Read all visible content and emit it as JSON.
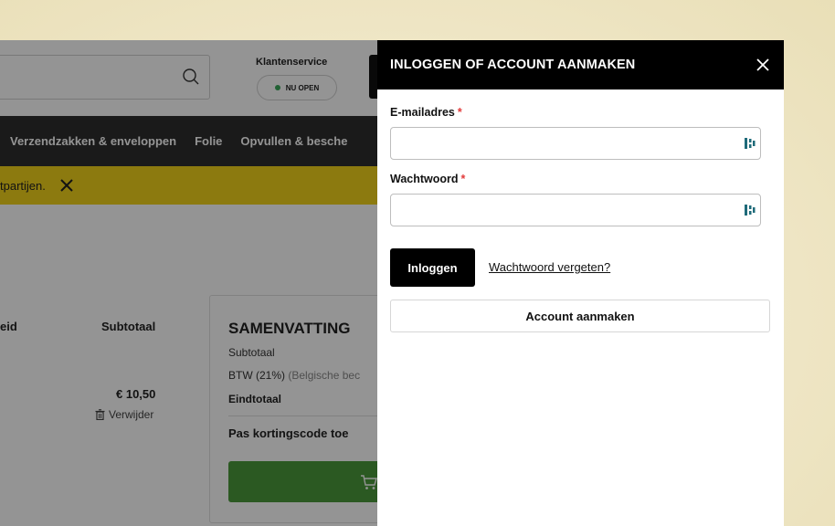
{
  "header": {
    "customer_service_label": "Klantenservice",
    "open_status": "NU OPEN"
  },
  "nav": {
    "items": [
      {
        "label": "Verzendzakken & enveloppen"
      },
      {
        "label": "Folie"
      },
      {
        "label": "Opvullen & besche"
      }
    ]
  },
  "notice": {
    "text": "tpartijen."
  },
  "cart": {
    "col_quantity": "eid",
    "col_subtotal": "Subtotaal",
    "item_price": "€ 10,50",
    "remove_label": "Verwijder"
  },
  "summary": {
    "title": "SAMENVATTING",
    "subtotal_label": "Subtotaal",
    "btw_label": "BTW (21%)",
    "btw_note": "(Belgische bec",
    "total_label": "Eindtotaal",
    "coupon_label": "Pas kortingscode toe"
  },
  "login": {
    "title": "INLOGGEN OF ACCOUNT AANMAKEN",
    "email_label": "E-mailadres",
    "password_label": "Wachtwoord",
    "required_mark": "*",
    "login_button": "Inloggen",
    "forgot_link": "Wachtwoord vergeten?",
    "create_account_button": "Account aanmaken"
  },
  "colors": {
    "drawer_header": "#000000",
    "required": "#e23b3b",
    "notice_bar": "#f1d21a",
    "checkout_button": "#4b9a3c"
  }
}
